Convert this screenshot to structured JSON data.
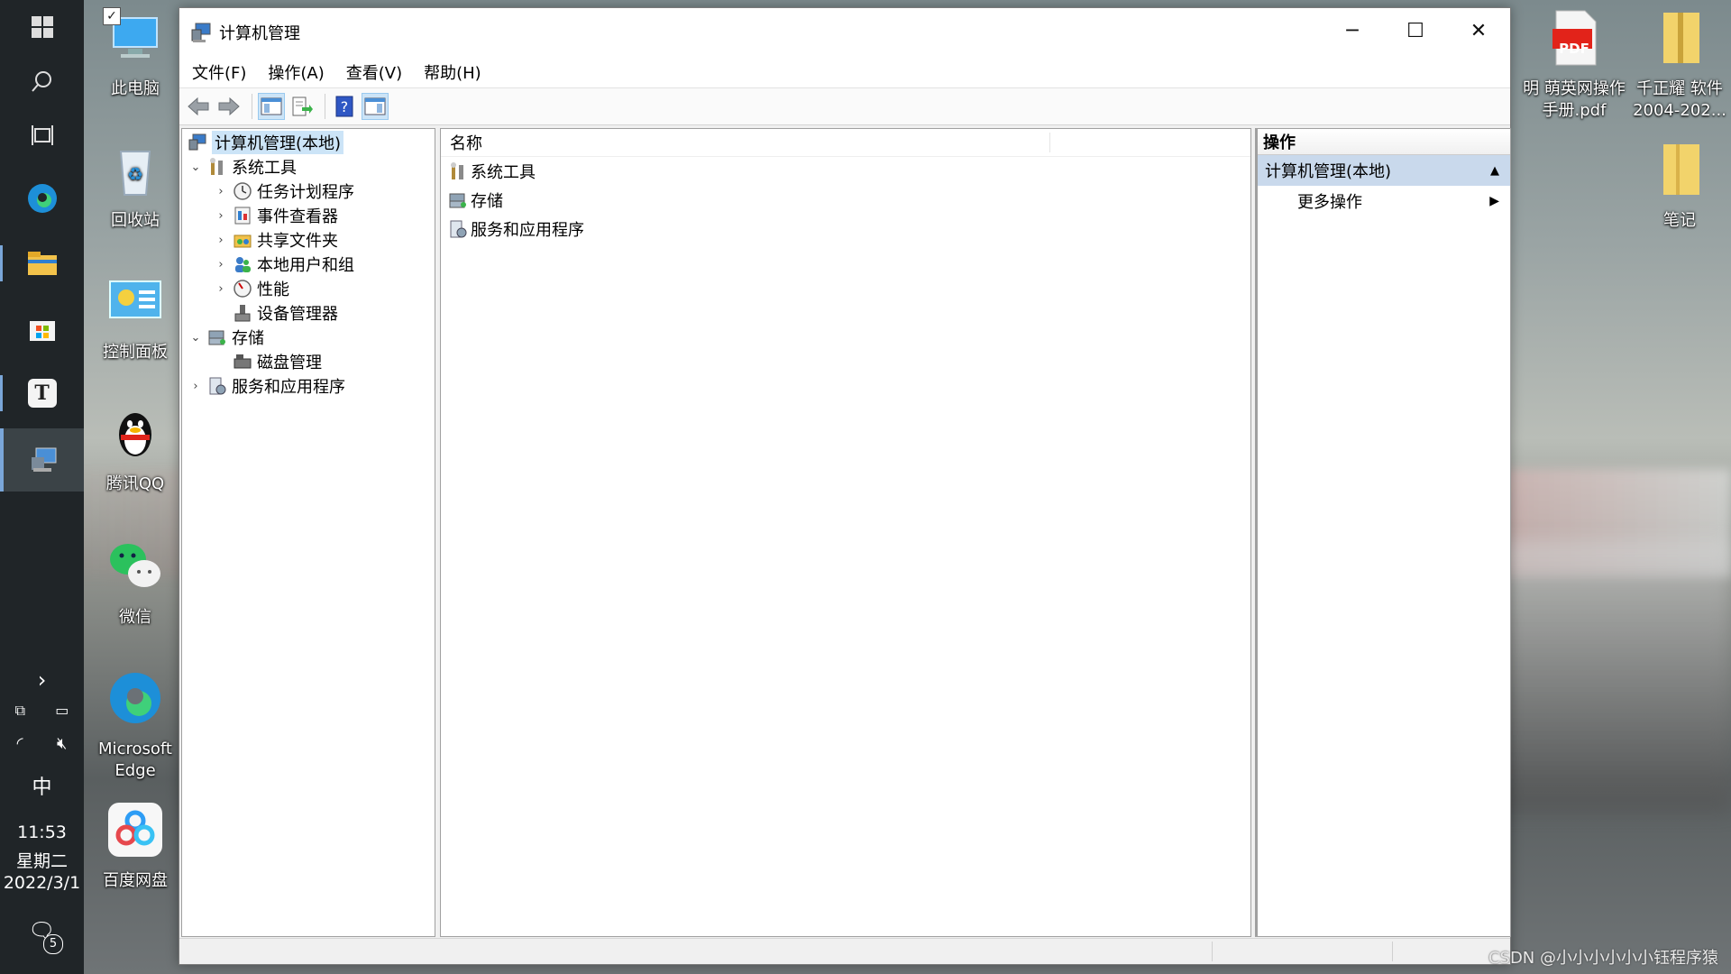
{
  "window": {
    "title": "计算机管理",
    "controls": {
      "minimize": "─",
      "maximize": "☐",
      "close": "✕"
    }
  },
  "menu": [
    "文件(F)",
    "操作(A)",
    "查看(V)",
    "帮助(H)"
  ],
  "tree": {
    "root": "计算机管理(本地)",
    "system_tools": "系统工具",
    "task_scheduler": "任务计划程序",
    "event_viewer": "事件查看器",
    "shared_folders": "共享文件夹",
    "local_users": "本地用户和组",
    "performance": "性能",
    "device_manager": "设备管理器",
    "storage": "存储",
    "disk_management": "磁盘管理",
    "services_apps": "服务和应用程序"
  },
  "list": {
    "column_name": "名称",
    "items": [
      "系统工具",
      "存储",
      "服务和应用程序"
    ]
  },
  "actions": {
    "header": "操作",
    "selected": "计算机管理(本地)",
    "more": "更多操作"
  },
  "desktop": {
    "icons_left": [
      "此电脑",
      "回收站",
      "控制面板",
      "腾讯QQ",
      "微信",
      "Microsoft Edge",
      "百度网盘"
    ],
    "icon_pdf": "明 萌英网操作手册.pdf",
    "icon_pdf_badge": "PDF",
    "icon_folder1": "千正耀 软件 2004-202...",
    "icon_folder2": "笔记"
  },
  "taskbar": {
    "ime": "中",
    "time": "11:53",
    "weekday": "星期二",
    "date": "2022/3/1",
    "notification_count": "5",
    "text_app_glyph": "T"
  },
  "watermark": "CSDN @小小小小小小钰程序猿"
}
